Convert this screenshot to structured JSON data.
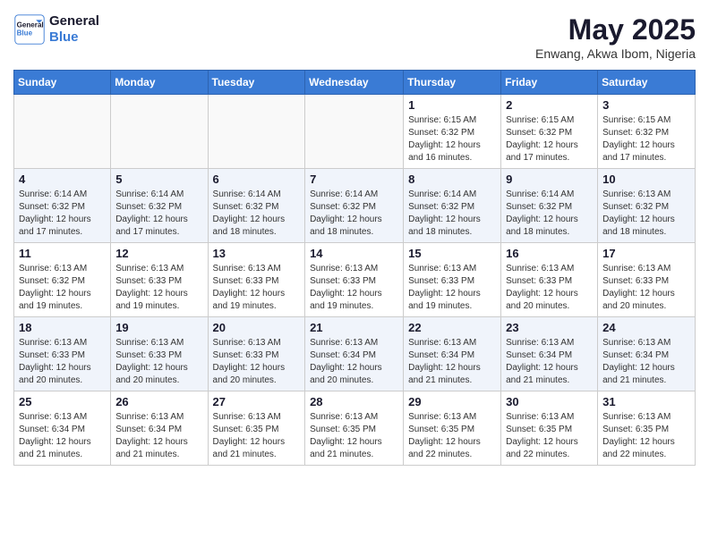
{
  "logo": {
    "line1": "General",
    "line2": "Blue"
  },
  "title": "May 2025",
  "location": "Enwang, Akwa Ibom, Nigeria",
  "days_header": [
    "Sunday",
    "Monday",
    "Tuesday",
    "Wednesday",
    "Thursday",
    "Friday",
    "Saturday"
  ],
  "weeks": [
    [
      {
        "day": "",
        "info": ""
      },
      {
        "day": "",
        "info": ""
      },
      {
        "day": "",
        "info": ""
      },
      {
        "day": "",
        "info": ""
      },
      {
        "day": "1",
        "info": "Sunrise: 6:15 AM\nSunset: 6:32 PM\nDaylight: 12 hours and 16 minutes."
      },
      {
        "day": "2",
        "info": "Sunrise: 6:15 AM\nSunset: 6:32 PM\nDaylight: 12 hours and 17 minutes."
      },
      {
        "day": "3",
        "info": "Sunrise: 6:15 AM\nSunset: 6:32 PM\nDaylight: 12 hours and 17 minutes."
      }
    ],
    [
      {
        "day": "4",
        "info": "Sunrise: 6:14 AM\nSunset: 6:32 PM\nDaylight: 12 hours and 17 minutes."
      },
      {
        "day": "5",
        "info": "Sunrise: 6:14 AM\nSunset: 6:32 PM\nDaylight: 12 hours and 17 minutes."
      },
      {
        "day": "6",
        "info": "Sunrise: 6:14 AM\nSunset: 6:32 PM\nDaylight: 12 hours and 18 minutes."
      },
      {
        "day": "7",
        "info": "Sunrise: 6:14 AM\nSunset: 6:32 PM\nDaylight: 12 hours and 18 minutes."
      },
      {
        "day": "8",
        "info": "Sunrise: 6:14 AM\nSunset: 6:32 PM\nDaylight: 12 hours and 18 minutes."
      },
      {
        "day": "9",
        "info": "Sunrise: 6:14 AM\nSunset: 6:32 PM\nDaylight: 12 hours and 18 minutes."
      },
      {
        "day": "10",
        "info": "Sunrise: 6:13 AM\nSunset: 6:32 PM\nDaylight: 12 hours and 18 minutes."
      }
    ],
    [
      {
        "day": "11",
        "info": "Sunrise: 6:13 AM\nSunset: 6:32 PM\nDaylight: 12 hours and 19 minutes."
      },
      {
        "day": "12",
        "info": "Sunrise: 6:13 AM\nSunset: 6:33 PM\nDaylight: 12 hours and 19 minutes."
      },
      {
        "day": "13",
        "info": "Sunrise: 6:13 AM\nSunset: 6:33 PM\nDaylight: 12 hours and 19 minutes."
      },
      {
        "day": "14",
        "info": "Sunrise: 6:13 AM\nSunset: 6:33 PM\nDaylight: 12 hours and 19 minutes."
      },
      {
        "day": "15",
        "info": "Sunrise: 6:13 AM\nSunset: 6:33 PM\nDaylight: 12 hours and 19 minutes."
      },
      {
        "day": "16",
        "info": "Sunrise: 6:13 AM\nSunset: 6:33 PM\nDaylight: 12 hours and 20 minutes."
      },
      {
        "day": "17",
        "info": "Sunrise: 6:13 AM\nSunset: 6:33 PM\nDaylight: 12 hours and 20 minutes."
      }
    ],
    [
      {
        "day": "18",
        "info": "Sunrise: 6:13 AM\nSunset: 6:33 PM\nDaylight: 12 hours and 20 minutes."
      },
      {
        "day": "19",
        "info": "Sunrise: 6:13 AM\nSunset: 6:33 PM\nDaylight: 12 hours and 20 minutes."
      },
      {
        "day": "20",
        "info": "Sunrise: 6:13 AM\nSunset: 6:33 PM\nDaylight: 12 hours and 20 minutes."
      },
      {
        "day": "21",
        "info": "Sunrise: 6:13 AM\nSunset: 6:34 PM\nDaylight: 12 hours and 20 minutes."
      },
      {
        "day": "22",
        "info": "Sunrise: 6:13 AM\nSunset: 6:34 PM\nDaylight: 12 hours and 21 minutes."
      },
      {
        "day": "23",
        "info": "Sunrise: 6:13 AM\nSunset: 6:34 PM\nDaylight: 12 hours and 21 minutes."
      },
      {
        "day": "24",
        "info": "Sunrise: 6:13 AM\nSunset: 6:34 PM\nDaylight: 12 hours and 21 minutes."
      }
    ],
    [
      {
        "day": "25",
        "info": "Sunrise: 6:13 AM\nSunset: 6:34 PM\nDaylight: 12 hours and 21 minutes."
      },
      {
        "day": "26",
        "info": "Sunrise: 6:13 AM\nSunset: 6:34 PM\nDaylight: 12 hours and 21 minutes."
      },
      {
        "day": "27",
        "info": "Sunrise: 6:13 AM\nSunset: 6:35 PM\nDaylight: 12 hours and 21 minutes."
      },
      {
        "day": "28",
        "info": "Sunrise: 6:13 AM\nSunset: 6:35 PM\nDaylight: 12 hours and 21 minutes."
      },
      {
        "day": "29",
        "info": "Sunrise: 6:13 AM\nSunset: 6:35 PM\nDaylight: 12 hours and 22 minutes."
      },
      {
        "day": "30",
        "info": "Sunrise: 6:13 AM\nSunset: 6:35 PM\nDaylight: 12 hours and 22 minutes."
      },
      {
        "day": "31",
        "info": "Sunrise: 6:13 AM\nSunset: 6:35 PM\nDaylight: 12 hours and 22 minutes."
      }
    ]
  ]
}
